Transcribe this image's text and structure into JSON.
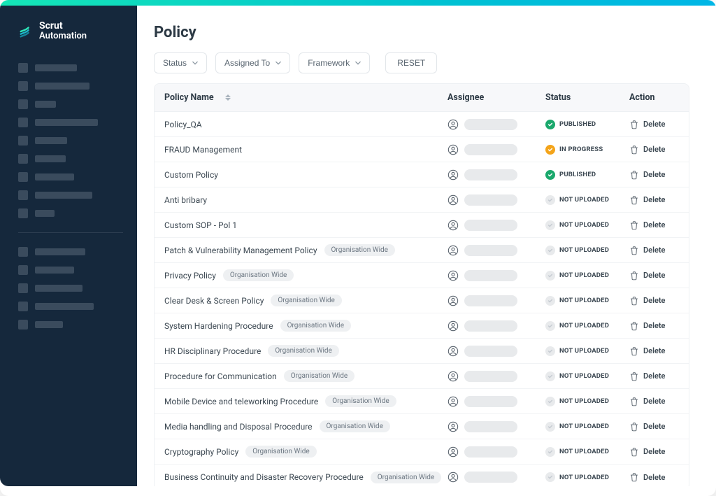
{
  "brand": {
    "line1": "Scrut",
    "line2": "Automation"
  },
  "page": {
    "title": "Policy"
  },
  "filters": {
    "status_label": "Status",
    "assigned_to_label": "Assigned To",
    "framework_label": "Framework",
    "reset_label": "RESET"
  },
  "table": {
    "headers": {
      "name": "Policy Name",
      "assignee": "Assignee",
      "status": "Status",
      "action": "Action"
    },
    "delete_label": "Delete",
    "rows": [
      {
        "name": "Policy_QA",
        "tag": "",
        "status": "PUBLISHED",
        "status_kind": "published"
      },
      {
        "name": "FRAUD Management",
        "tag": "",
        "status": "IN PROGRESS",
        "status_kind": "inprogress"
      },
      {
        "name": "Custom Policy",
        "tag": "",
        "status": "PUBLISHED",
        "status_kind": "published"
      },
      {
        "name": "Anti bribary",
        "tag": "",
        "status": "NOT UPLOADED",
        "status_kind": "notuploaded"
      },
      {
        "name": "Custom SOP - Pol 1",
        "tag": "",
        "status": "NOT UPLOADED",
        "status_kind": "notuploaded"
      },
      {
        "name": "Patch & Vulnerability Management Policy",
        "tag": "Organisation Wide",
        "status": "NOT UPLOADED",
        "status_kind": "notuploaded"
      },
      {
        "name": "Privacy Policy",
        "tag": "Organisation Wide",
        "status": "NOT UPLOADED",
        "status_kind": "notuploaded"
      },
      {
        "name": "Clear Desk & Screen Policy",
        "tag": "Organisation Wide",
        "status": "NOT UPLOADED",
        "status_kind": "notuploaded"
      },
      {
        "name": "System Hardening Procedure",
        "tag": "Organisation Wide",
        "status": "NOT UPLOADED",
        "status_kind": "notuploaded"
      },
      {
        "name": "HR Disciplinary Procedure",
        "tag": "Organisation Wide",
        "status": "NOT UPLOADED",
        "status_kind": "notuploaded"
      },
      {
        "name": "Procedure for Communication",
        "tag": "Organisation Wide",
        "status": "NOT UPLOADED",
        "status_kind": "notuploaded"
      },
      {
        "name": "Mobile Device and teleworking Procedure",
        "tag": "Organisation Wide",
        "status": "NOT UPLOADED",
        "status_kind": "notuploaded"
      },
      {
        "name": "Media handling and Disposal Procedure",
        "tag": "Organisation Wide",
        "status": "NOT UPLOADED",
        "status_kind": "notuploaded"
      },
      {
        "name": "Cryptography Policy",
        "tag": "Organisation Wide",
        "status": "NOT UPLOADED",
        "status_kind": "notuploaded"
      },
      {
        "name": "Business Continuity and Disaster Recovery Procedure",
        "tag": "Organisation Wide",
        "status": "NOT UPLOADED",
        "status_kind": "notuploaded"
      }
    ]
  },
  "sidebar": {
    "group1_widths": [
      60,
      78,
      30,
      90,
      46,
      44,
      56,
      82,
      28
    ],
    "group2_widths": [
      72,
      56,
      68,
      84,
      40
    ]
  }
}
